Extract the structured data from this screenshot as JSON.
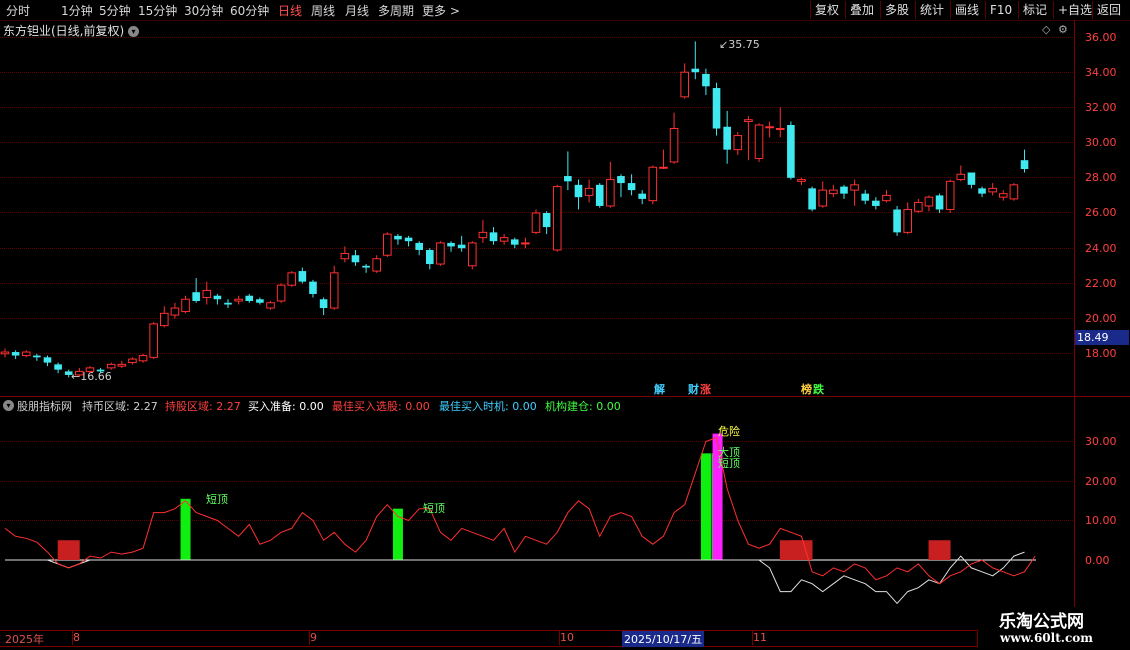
{
  "toolbar": {
    "periods": [
      "分时",
      "1分钟",
      "5分钟",
      "15分钟",
      "30分钟",
      "60分钟",
      "日线",
      "周线",
      "月线",
      "多周期",
      "更多 >"
    ],
    "active_period": "日线",
    "right_buttons": [
      "复权",
      "叠加",
      "多股",
      "统计",
      "画线",
      "F10",
      "标记",
      "+自选",
      "返回"
    ]
  },
  "main_chart": {
    "title": "东方钽业(日线,前复权)",
    "high_label": "35.75",
    "low_label": "16.66",
    "current_price": "18.49",
    "y_ticks": [
      "36.00",
      "34.00",
      "32.00",
      "30.00",
      "28.00",
      "26.00",
      "24.00",
      "22.00",
      "20.00",
      "18.00"
    ],
    "events": [
      {
        "label": "解",
        "color": "#40d0ff"
      },
      {
        "label": "财",
        "color": "#40d0ff"
      },
      {
        "label": "涨",
        "color": "#ff4040"
      },
      {
        "label": "榜",
        "color": "#ffd040"
      },
      {
        "label": "跌",
        "color": "#40ff40"
      }
    ]
  },
  "indicator_panel": {
    "name": "股朋指标网",
    "legend": [
      {
        "label": "持币区域: 2.27",
        "color": "#d0d0d0"
      },
      {
        "label": "持股区域: 2.27",
        "color": "#ff4040"
      },
      {
        "label": "买入准备: 0.00",
        "color": "#ffffff"
      },
      {
        "label": "最佳买入选股: 0.00",
        "color": "#ff4040"
      },
      {
        "label": "最佳买入时机: 0.00",
        "color": "#40d0ff"
      },
      {
        "label": "机构建仓: 0.00",
        "color": "#40ff40"
      }
    ],
    "y_ticks": [
      "30.00",
      "20.00",
      "10.00",
      "0.00"
    ],
    "annotations": {
      "short_top": "短顶",
      "danger": "危险",
      "big_top": "大顶"
    }
  },
  "time_axis": {
    "labels": [
      "2025年",
      "8",
      "9",
      "10",
      "2025/10/17/五",
      "11"
    ]
  },
  "watermark": {
    "line1": "乐淘公式网",
    "line2": "www.60lt.com"
  },
  "chart_data": {
    "type": "candlestick",
    "title": "东方钽业(日线,前复权)",
    "ylim": [
      16.0,
      37.0
    ],
    "highest": 35.75,
    "lowest": 16.66,
    "last_price": 18.49,
    "series": [
      {
        "name": "K线",
        "values": [
          [
            18.0,
            18.1,
            17.8,
            18.3
          ],
          [
            18.1,
            17.9,
            17.7,
            18.2
          ],
          [
            17.9,
            18.1,
            17.8,
            18.2
          ],
          [
            17.9,
            17.8,
            17.6,
            18.0
          ],
          [
            17.8,
            17.5,
            17.3,
            17.9
          ],
          [
            17.4,
            17.1,
            16.9,
            17.5
          ],
          [
            17.0,
            16.8,
            16.66,
            17.1
          ],
          [
            16.8,
            17.0,
            16.7,
            17.2
          ],
          [
            17.0,
            17.2,
            16.9,
            17.3
          ],
          [
            17.1,
            17.0,
            16.9,
            17.2
          ],
          [
            17.2,
            17.4,
            17.1,
            17.5
          ],
          [
            17.3,
            17.4,
            17.2,
            17.6
          ],
          [
            17.5,
            17.7,
            17.4,
            17.8
          ],
          [
            17.6,
            17.9,
            17.5,
            18.0
          ],
          [
            17.8,
            19.7,
            17.7,
            19.8
          ],
          [
            19.6,
            20.3,
            19.5,
            20.7
          ],
          [
            20.2,
            20.6,
            20.0,
            20.9
          ],
          [
            20.4,
            21.1,
            20.3,
            21.3
          ],
          [
            21.5,
            21.0,
            20.9,
            22.3
          ],
          [
            21.2,
            21.6,
            20.8,
            22.1
          ],
          [
            21.3,
            21.1,
            20.8,
            21.4
          ],
          [
            20.9,
            20.8,
            20.6,
            21.1
          ],
          [
            21.0,
            21.1,
            20.8,
            21.3
          ],
          [
            21.3,
            21.0,
            20.9,
            21.4
          ],
          [
            21.1,
            20.9,
            20.8,
            21.2
          ],
          [
            20.6,
            20.9,
            20.5,
            21.0
          ],
          [
            21.0,
            21.9,
            20.9,
            22.0
          ],
          [
            21.9,
            22.6,
            21.8,
            22.7
          ],
          [
            22.7,
            22.1,
            22.0,
            22.9
          ],
          [
            22.1,
            21.4,
            21.2,
            22.2
          ],
          [
            21.1,
            20.6,
            20.2,
            21.2
          ],
          [
            20.6,
            22.6,
            20.5,
            23.0
          ],
          [
            23.4,
            23.7,
            23.2,
            24.1
          ],
          [
            23.6,
            23.2,
            23.0,
            23.9
          ],
          [
            23.0,
            22.9,
            22.6,
            23.1
          ],
          [
            22.7,
            23.4,
            22.6,
            23.6
          ],
          [
            23.6,
            24.8,
            23.5,
            24.9
          ],
          [
            24.7,
            24.5,
            24.2,
            24.8
          ],
          [
            24.6,
            24.4,
            24.1,
            24.7
          ],
          [
            24.3,
            23.9,
            23.6,
            24.4
          ],
          [
            23.9,
            23.1,
            22.8,
            24.0
          ],
          [
            23.1,
            24.3,
            23.0,
            24.4
          ],
          [
            24.3,
            24.1,
            23.8,
            24.4
          ],
          [
            24.2,
            24.0,
            23.8,
            24.7
          ],
          [
            23.0,
            24.3,
            22.8,
            24.4
          ],
          [
            24.6,
            24.9,
            24.3,
            25.6
          ],
          [
            24.9,
            24.4,
            24.2,
            25.2
          ],
          [
            24.4,
            24.6,
            24.2,
            24.8
          ],
          [
            24.5,
            24.2,
            24.0,
            24.6
          ],
          [
            24.3,
            24.3,
            24.0,
            24.6
          ],
          [
            24.9,
            26.0,
            24.8,
            26.2
          ],
          [
            26.0,
            25.2,
            24.8,
            26.1
          ],
          [
            23.9,
            27.5,
            23.8,
            27.6
          ],
          [
            28.1,
            27.8,
            27.3,
            29.5
          ],
          [
            27.6,
            26.9,
            26.2,
            27.9
          ],
          [
            27.0,
            27.4,
            26.6,
            27.9
          ],
          [
            27.6,
            26.4,
            26.3,
            27.7
          ],
          [
            26.4,
            27.9,
            26.3,
            28.9
          ],
          [
            28.1,
            27.7,
            26.9,
            28.2
          ],
          [
            27.7,
            27.3,
            27.0,
            28.2
          ],
          [
            27.1,
            26.8,
            26.5,
            27.3
          ],
          [
            26.7,
            28.6,
            26.5,
            28.7
          ],
          [
            28.6,
            28.6,
            28.5,
            29.6
          ],
          [
            28.9,
            30.8,
            28.8,
            31.7
          ],
          [
            32.6,
            34.0,
            32.5,
            34.5
          ],
          [
            34.2,
            34.0,
            33.6,
            35.75
          ],
          [
            33.9,
            33.2,
            32.7,
            34.2
          ],
          [
            33.1,
            30.8,
            30.4,
            33.4
          ],
          [
            30.9,
            29.6,
            28.8,
            31.8
          ],
          [
            29.6,
            30.4,
            29.3,
            30.6
          ],
          [
            31.2,
            31.3,
            29.0,
            31.5
          ],
          [
            29.1,
            31.0,
            28.9,
            31.1
          ],
          [
            30.9,
            30.9,
            30.3,
            31.2
          ],
          [
            30.8,
            30.8,
            30.3,
            32.0
          ],
          [
            31.0,
            28.0,
            27.9,
            31.2
          ],
          [
            27.8,
            27.9,
            27.6,
            28.0
          ],
          [
            27.4,
            26.2,
            26.1,
            27.5
          ],
          [
            26.4,
            27.3,
            26.3,
            27.8
          ],
          [
            27.1,
            27.3,
            26.9,
            27.6
          ],
          [
            27.5,
            27.1,
            26.8,
            27.6
          ],
          [
            27.3,
            27.6,
            26.4,
            27.9
          ],
          [
            27.1,
            26.7,
            26.5,
            27.3
          ],
          [
            26.7,
            26.4,
            26.2,
            26.9
          ],
          [
            26.7,
            27.0,
            26.6,
            27.3
          ],
          [
            26.2,
            24.9,
            24.7,
            26.4
          ],
          [
            24.9,
            26.2,
            24.8,
            26.6
          ],
          [
            26.1,
            26.6,
            26.0,
            26.8
          ],
          [
            26.4,
            26.9,
            26.1,
            27.0
          ],
          [
            27.0,
            26.2,
            26.0,
            27.1
          ],
          [
            26.2,
            27.8,
            26.0,
            27.9
          ],
          [
            27.9,
            28.2,
            27.8,
            28.7
          ],
          [
            28.3,
            27.6,
            27.4,
            28.3
          ],
          [
            27.4,
            27.1,
            26.9,
            27.5
          ],
          [
            27.2,
            27.4,
            27.0,
            27.7
          ],
          [
            26.9,
            27.1,
            26.7,
            27.3
          ],
          [
            26.8,
            27.6,
            26.7,
            27.7
          ],
          [
            29.0,
            28.5,
            28.3,
            29.6
          ]
        ]
      },
      {
        "name": "持股区域",
        "values": [
          8,
          6,
          5.5,
          4.5,
          2,
          -1,
          -2,
          -1,
          1,
          0.5,
          2,
          1.5,
          2,
          3,
          12,
          12,
          13,
          15,
          12,
          11,
          10,
          8,
          6,
          9,
          4,
          5,
          7,
          8,
          12,
          10,
          5,
          7,
          4,
          2,
          5,
          11,
          14,
          11,
          10,
          13,
          13,
          7,
          5,
          8,
          7,
          6,
          5,
          8,
          2,
          6,
          5,
          4,
          7,
          12,
          15,
          13,
          6,
          11,
          12,
          11,
          6,
          4,
          6,
          12,
          14,
          22,
          30,
          31,
          18,
          10,
          4,
          3,
          4,
          8,
          7,
          6,
          -3,
          -4,
          -2,
          -3,
          -1,
          -2,
          -5,
          -4,
          -2,
          -3,
          -1,
          -4,
          -6,
          -4,
          -3,
          -1,
          0,
          -2,
          -3,
          -4,
          -3,
          1
        ]
      },
      {
        "name": "持币区域",
        "values": [
          0,
          0,
          0,
          0,
          0,
          -1,
          -2,
          -1,
          0,
          0,
          0,
          0,
          0,
          0,
          0,
          0,
          0,
          0,
          0,
          0,
          0,
          0,
          0,
          0,
          0,
          0,
          0,
          0,
          0,
          0,
          0,
          0,
          0,
          0,
          0,
          0,
          0,
          0,
          0,
          0,
          0,
          0,
          0,
          0,
          0,
          0,
          0,
          0,
          0,
          0,
          0,
          0,
          0,
          0,
          0,
          0,
          0,
          0,
          0,
          0,
          0,
          0,
          0,
          0,
          0,
          0,
          0,
          0,
          0,
          0,
          0,
          0,
          -2,
          -8,
          -8,
          -5,
          -6,
          -8,
          -6,
          -4,
          -5,
          -6,
          -8,
          -8,
          -11,
          -8,
          -7,
          -5,
          -6,
          -2,
          1,
          -2,
          -3,
          -4,
          -2,
          1,
          2
        ]
      },
      {
        "name": "短顶",
        "values": [
          0,
          0,
          0,
          0,
          0,
          0,
          0,
          0,
          0,
          0,
          0,
          0,
          0,
          0,
          0,
          0,
          0,
          15.5,
          0,
          0,
          0,
          0,
          0,
          0,
          0,
          0,
          0,
          0,
          0,
          0,
          0,
          0,
          0,
          0,
          0,
          0,
          0,
          13,
          0,
          0,
          0,
          0,
          0,
          0,
          0,
          0,
          0,
          0,
          0,
          0,
          0,
          0,
          0,
          0,
          0,
          0,
          0,
          0,
          0,
          0,
          0,
          0,
          0,
          0,
          0,
          0,
          27,
          27,
          0,
          0,
          0,
          0,
          0,
          0,
          0,
          0,
          0,
          0,
          0,
          0,
          0,
          0,
          0,
          0,
          0,
          0,
          0,
          0,
          0,
          0,
          0,
          0,
          0,
          0,
          0,
          0,
          0
        ]
      },
      {
        "name": "危险",
        "values": [
          0,
          0,
          0,
          0,
          0,
          0,
          0,
          0,
          0,
          0,
          0,
          0,
          0,
          0,
          0,
          0,
          0,
          0,
          0,
          0,
          0,
          0,
          0,
          0,
          0,
          0,
          0,
          0,
          0,
          0,
          0,
          0,
          0,
          0,
          0,
          0,
          0,
          0,
          0,
          0,
          0,
          0,
          0,
          0,
          0,
          0,
          0,
          0,
          0,
          0,
          0,
          0,
          0,
          0,
          0,
          0,
          0,
          0,
          0,
          0,
          0,
          0,
          0,
          0,
          0,
          0,
          0,
          32,
          0,
          0,
          0,
          0,
          0,
          0,
          0,
          0,
          0,
          0,
          0,
          0,
          0,
          0,
          0,
          0,
          0,
          0,
          0,
          0,
          0,
          0,
          0,
          0,
          0,
          0,
          0,
          0,
          0
        ]
      },
      {
        "name": "买入准备",
        "values": [
          0,
          0,
          0,
          0,
          0,
          0,
          5,
          0,
          0,
          0,
          0,
          0,
          0,
          0,
          0,
          0,
          0,
          0,
          0,
          0,
          0,
          0,
          0,
          0,
          0,
          0,
          0,
          0,
          0,
          0,
          0,
          0,
          0,
          0,
          0,
          0,
          0,
          0,
          0,
          0,
          0,
          0,
          0,
          0,
          0,
          0,
          0,
          0,
          0,
          0,
          0,
          0,
          0,
          0,
          0,
          0,
          0,
          0,
          0,
          0,
          0,
          0,
          0,
          0,
          0,
          0,
          0,
          0,
          0,
          0,
          0,
          0,
          0,
          0,
          5,
          5,
          0,
          0,
          0,
          0,
          0,
          0,
          0,
          0,
          0,
          0,
          0,
          0,
          5,
          0,
          0,
          0,
          0,
          0,
          0,
          0,
          0
        ]
      }
    ]
  }
}
